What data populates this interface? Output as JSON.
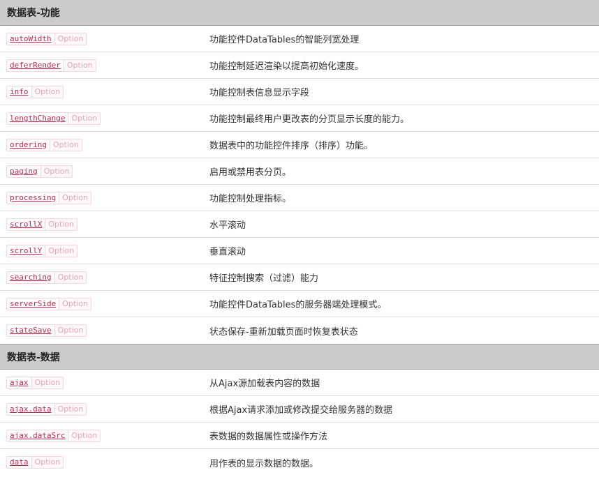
{
  "sections": [
    {
      "title": "数据表-功能",
      "rows": [
        {
          "name": "autoWidth",
          "type": "Option",
          "desc": "功能控件DataTables的智能列宽处理"
        },
        {
          "name": "deferRender",
          "type": "Option",
          "desc": "功能控制延迟渲染以提高初始化速度。"
        },
        {
          "name": "info",
          "type": "Option",
          "desc": "功能控制表信息显示字段"
        },
        {
          "name": "lengthChange",
          "type": "Option",
          "desc": "功能控制最终用户更改表的分页显示长度的能力。"
        },
        {
          "name": "ordering",
          "type": "Option",
          "desc": "数据表中的功能控件排序（排序）功能。"
        },
        {
          "name": "paging",
          "type": "Option",
          "desc": "启用或禁用表分页。"
        },
        {
          "name": "processing",
          "type": "Option",
          "desc": "功能控制处理指标。"
        },
        {
          "name": "scrollX",
          "type": "Option",
          "desc": "水平滚动"
        },
        {
          "name": "scrollY",
          "type": "Option",
          "desc": "垂直滚动"
        },
        {
          "name": "searching",
          "type": "Option",
          "desc": "特征控制搜索（过滤）能力"
        },
        {
          "name": "serverSide",
          "type": "Option",
          "desc": "功能控件DataTables的服务器端处理模式。"
        },
        {
          "name": "stateSave",
          "type": "Option",
          "desc": "状态保存-重新加载页面时恢复表状态"
        }
      ]
    },
    {
      "title": "数据表-数据",
      "rows": [
        {
          "name": "ajax",
          "type": "Option",
          "desc": "从Ajax源加载表内容的数据"
        },
        {
          "name": "ajax.data",
          "type": "Option",
          "desc": "根据Ajax请求添加或修改提交给服务器的数据"
        },
        {
          "name": "ajax.dataSrc",
          "type": "Option",
          "desc": "表数据的数据属性或操作方法"
        },
        {
          "name": "data",
          "type": "Option",
          "desc": "用作表的显示数据的数据。"
        }
      ]
    }
  ]
}
